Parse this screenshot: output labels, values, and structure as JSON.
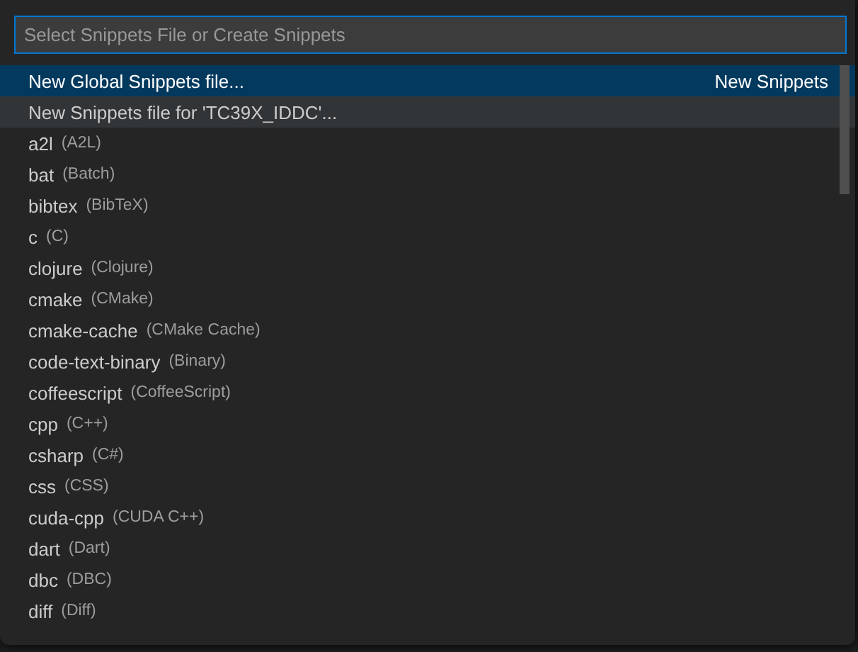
{
  "search": {
    "placeholder": "Select Snippets File or Create Snippets"
  },
  "items": [
    {
      "label": "New Global Snippets file...",
      "selected": true,
      "hovered": false,
      "group_label": "New Snippets"
    },
    {
      "label": "New Snippets file for 'TC39X_IDDC'...",
      "selected": false,
      "hovered": true
    },
    {
      "label": "a2l",
      "description": "(A2L)",
      "selected": false,
      "hovered": false
    },
    {
      "label": "bat",
      "description": "(Batch)",
      "selected": false,
      "hovered": false
    },
    {
      "label": "bibtex",
      "description": "(BibTeX)",
      "selected": false,
      "hovered": false
    },
    {
      "label": "c",
      "description": "(C)",
      "selected": false,
      "hovered": false
    },
    {
      "label": "clojure",
      "description": "(Clojure)",
      "selected": false,
      "hovered": false
    },
    {
      "label": "cmake",
      "description": "(CMake)",
      "selected": false,
      "hovered": false
    },
    {
      "label": "cmake-cache",
      "description": "(CMake Cache)",
      "selected": false,
      "hovered": false
    },
    {
      "label": "code-text-binary",
      "description": "(Binary)",
      "selected": false,
      "hovered": false
    },
    {
      "label": "coffeescript",
      "description": "(CoffeeScript)",
      "selected": false,
      "hovered": false
    },
    {
      "label": "cpp",
      "description": "(C++)",
      "selected": false,
      "hovered": false
    },
    {
      "label": "csharp",
      "description": "(C#)",
      "selected": false,
      "hovered": false
    },
    {
      "label": "css",
      "description": "(CSS)",
      "selected": false,
      "hovered": false
    },
    {
      "label": "cuda-cpp",
      "description": "(CUDA C++)",
      "selected": false,
      "hovered": false
    },
    {
      "label": "dart",
      "description": "(Dart)",
      "selected": false,
      "hovered": false
    },
    {
      "label": "dbc",
      "description": "(DBC)",
      "selected": false,
      "hovered": false
    },
    {
      "label": "diff",
      "description": "(Diff)",
      "selected": false,
      "hovered": false
    }
  ]
}
